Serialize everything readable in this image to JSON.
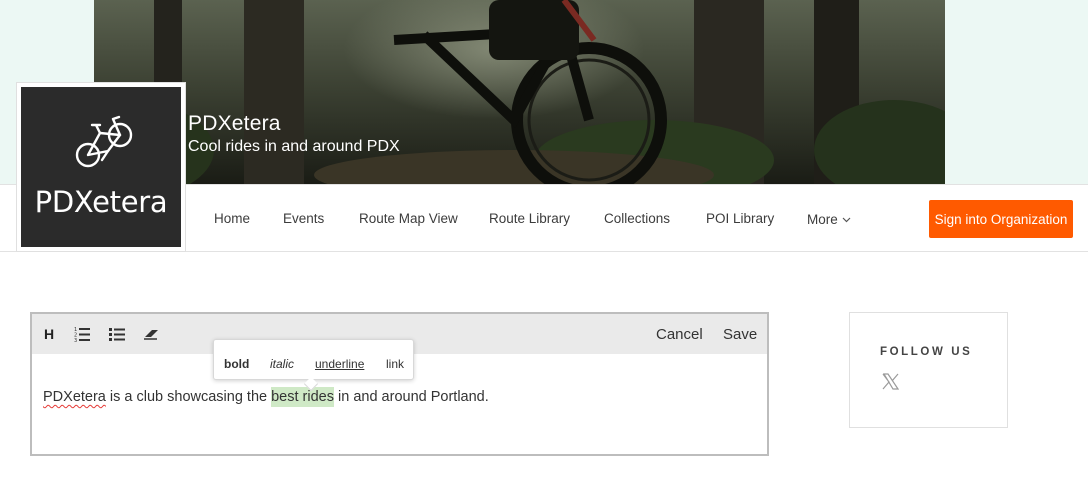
{
  "org": {
    "name": "PDXetera",
    "tagline": "Cool rides in and around PDX",
    "logo_text": "PDXetera"
  },
  "nav": {
    "items": [
      {
        "label": "Home"
      },
      {
        "label": "Events"
      },
      {
        "label": "Route Map View"
      },
      {
        "label": "Route Library"
      },
      {
        "label": "Collections"
      },
      {
        "label": "POI Library"
      },
      {
        "label": "More"
      }
    ],
    "signin_label": "Sign into Organization"
  },
  "editor": {
    "toolbar": {
      "heading_label": "H",
      "cancel_label": "Cancel",
      "save_label": "Save"
    },
    "content": {
      "misspelled": "PDXetera",
      "before": " is a club showcasing the ",
      "selected": "best rides",
      "after": " in and around Portland."
    },
    "format_popup": {
      "bold": "bold",
      "italic": "italic",
      "underline": "underline",
      "link": "link"
    }
  },
  "follow": {
    "title": "FOLLOW US"
  },
  "colors": {
    "accent": "#ff5a00",
    "banner_bg": "#ecf8f4",
    "highlight": "#cfe9c6",
    "logo_bg": "#2b2b2b"
  },
  "icons": [
    "bicycle-icon",
    "chevron-down-icon",
    "ordered-list-icon",
    "bullet-list-icon",
    "eraser-icon",
    "x-logo-icon"
  ]
}
